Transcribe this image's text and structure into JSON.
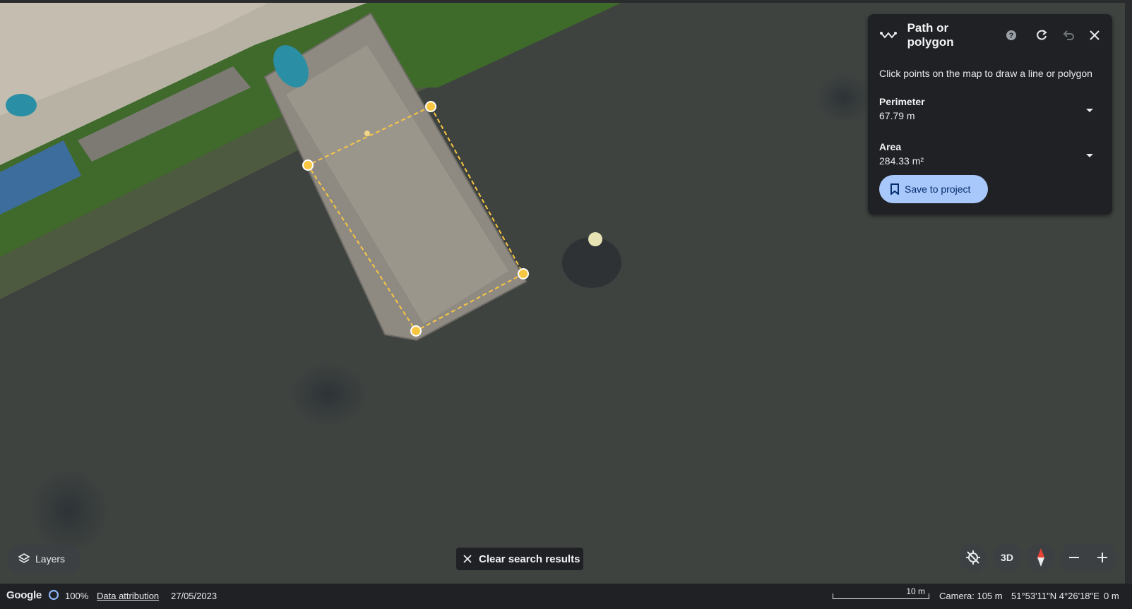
{
  "panel": {
    "title": "Path or polygon",
    "description": "Click points on the map to draw a line or polygon",
    "perimeter_label": "Perimeter",
    "perimeter_value": "67.79 m",
    "area_label": "Area",
    "area_value": "284.33 m²",
    "save_label": "Save to project",
    "icons": [
      "path-icon",
      "help-icon",
      "redo-icon",
      "undo-icon",
      "close-icon",
      "chevron-down-icon",
      "bookmark-icon"
    ]
  },
  "controls": {
    "layers_label": "Layers",
    "clear_search_label": "Clear search results",
    "threed_label": "3D",
    "icons": [
      "layers-icon",
      "close-icon",
      "location-off-icon",
      "compass-icon",
      "zoom-out-icon",
      "zoom-in-icon"
    ]
  },
  "status": {
    "logo": "Google",
    "loading_percent": "100%",
    "data_attribution": "Data attribution",
    "imagery_date": "27/05/2023",
    "scale": "10 m",
    "camera": "Camera: 105 m",
    "coordinates": "51°53'11\"N 4°26'18\"E",
    "elevation": "0 m"
  },
  "colors": {
    "water": "#3e4340",
    "measure_line": "#f9c642",
    "panel_bg": "#202124",
    "button_accent": "#a8c7fa"
  }
}
